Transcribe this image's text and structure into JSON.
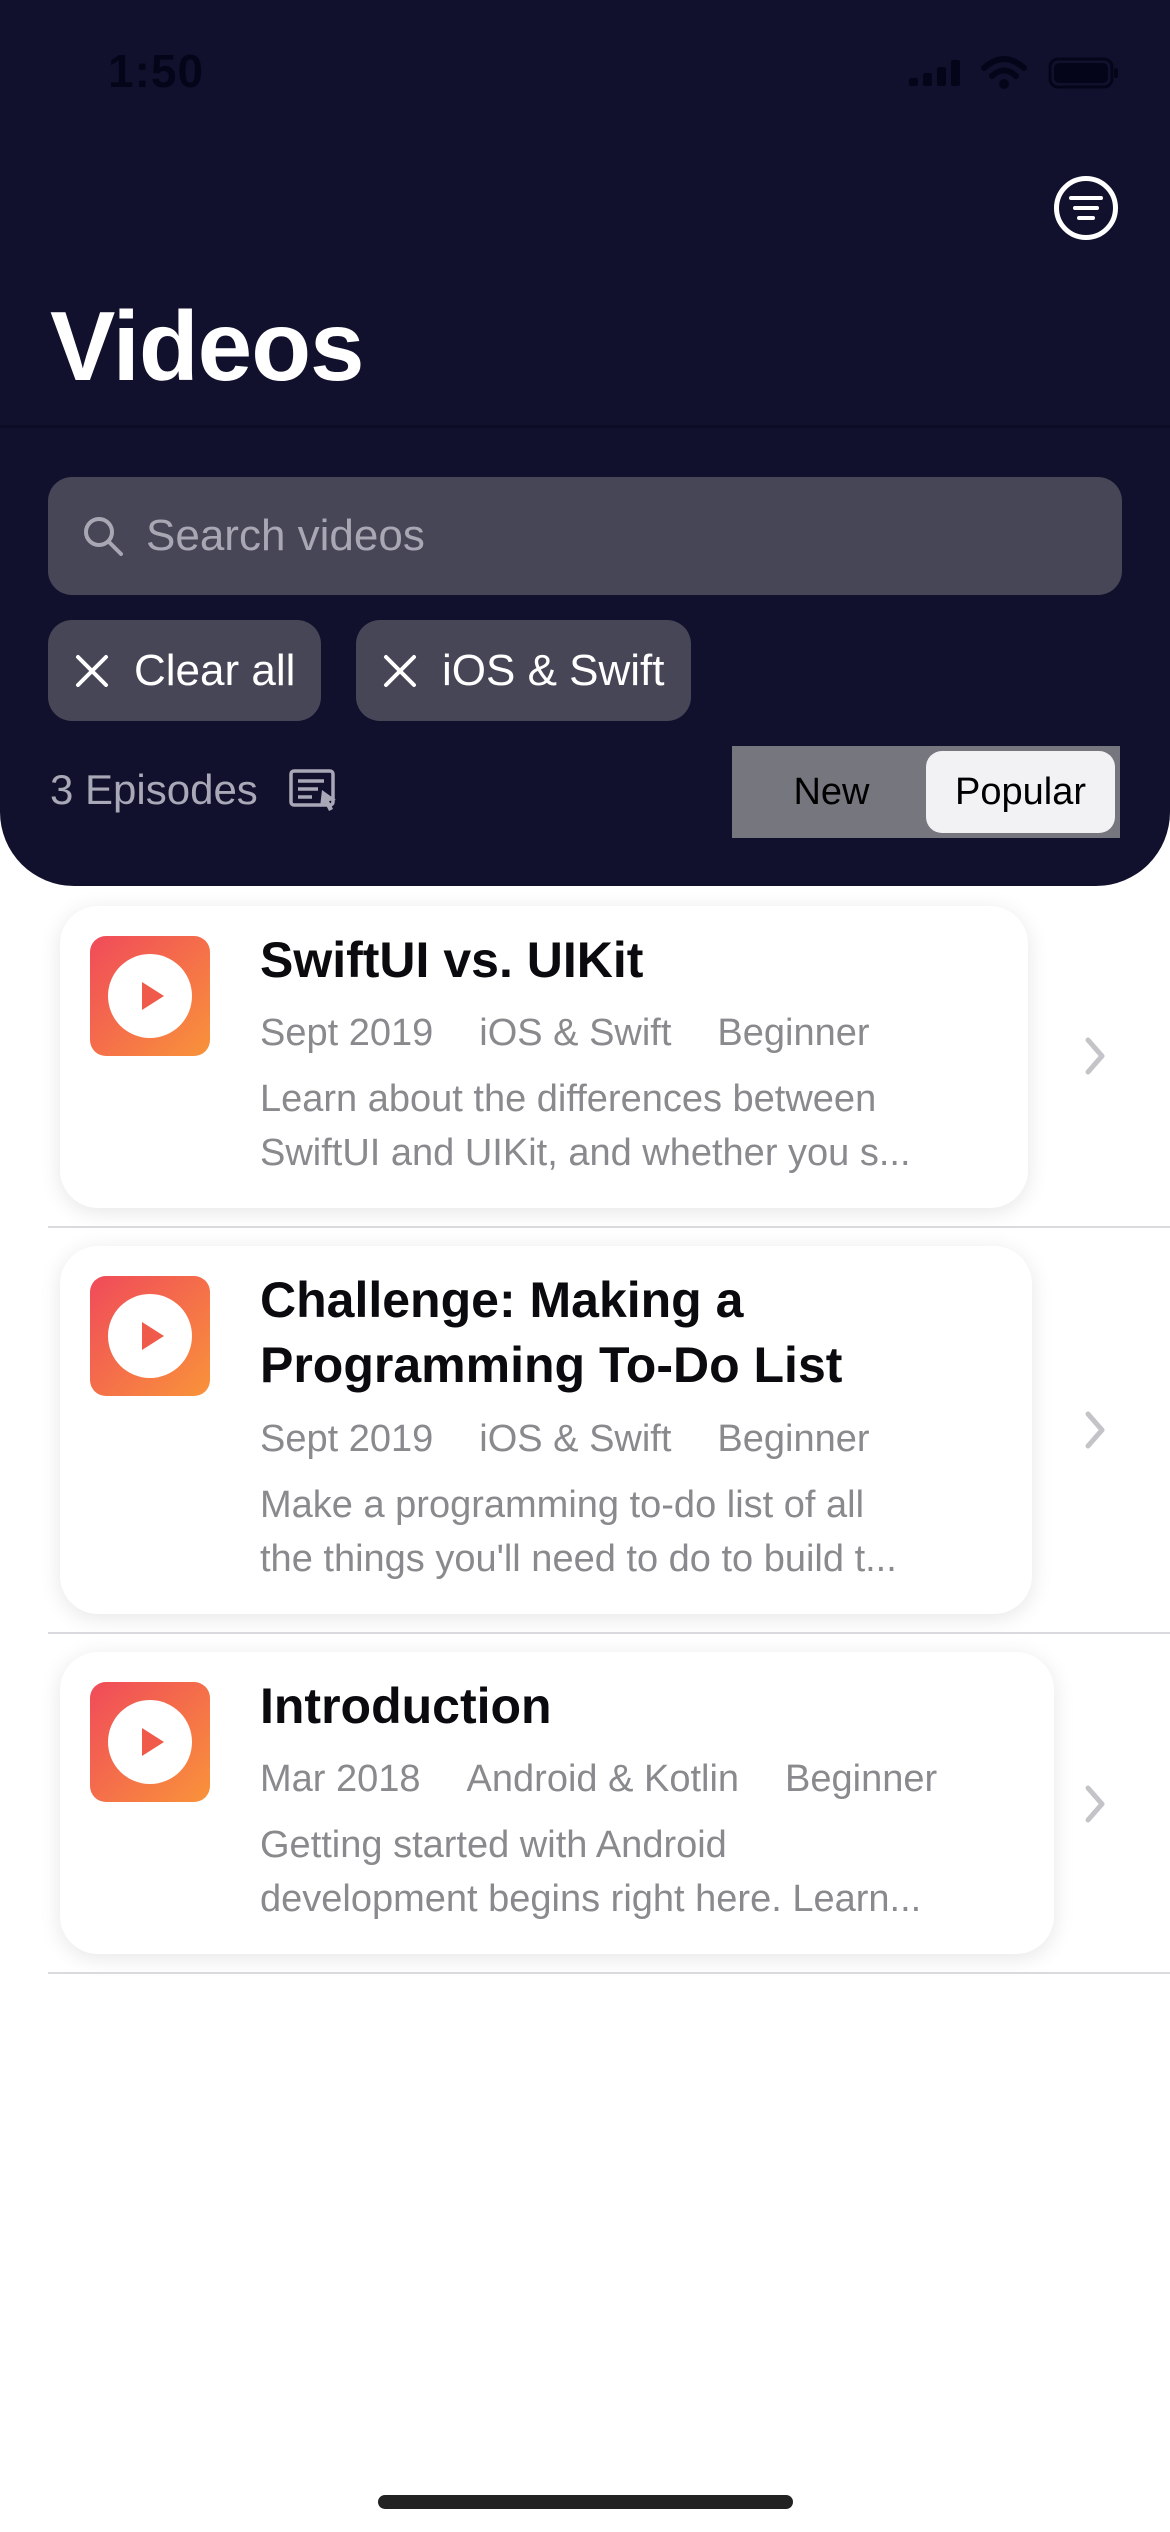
{
  "status_bar": {
    "time": "1:50",
    "icons": [
      "signal-icon",
      "wifi-icon",
      "battery-icon"
    ]
  },
  "header": {
    "title": "Videos",
    "filter_icon": "filter-icon",
    "search": {
      "placeholder": "Search videos",
      "value": ""
    },
    "chips": [
      {
        "label": "Clear all"
      },
      {
        "label": "iOS & Swift"
      }
    ],
    "episode_count": "3 Episodes",
    "sort_options": [
      {
        "label": "New",
        "selected": false
      },
      {
        "label": "Popular",
        "selected": true
      }
    ]
  },
  "videos": [
    {
      "title": "SwiftUI vs. UIKit",
      "date": "Sept 2019",
      "category": "iOS & Swift",
      "level": "Beginner",
      "description_lines": [
        "Learn about the differences between",
        "SwiftUI and UIKit, and whether you s..."
      ]
    },
    {
      "title_lines": [
        "Challenge: Making a",
        "Programming To-Do List"
      ],
      "date": "Sept 2019",
      "category": "iOS & Swift",
      "level": "Beginner",
      "description_lines": [
        "Make a programming to-do list of all",
        "the things you'll need to do to build t..."
      ]
    },
    {
      "title": "Introduction",
      "date": "Mar 2018",
      "category": "Android & Kotlin",
      "level": "Beginner",
      "description_lines": [
        "Getting started with Android",
        "development begins right here. Learn..."
      ]
    }
  ],
  "colors": {
    "header_bg": "#11112e",
    "chip_bg": "#474657",
    "play_gradient_start": "#f04a5a",
    "play_gradient_end": "#f9933a"
  }
}
